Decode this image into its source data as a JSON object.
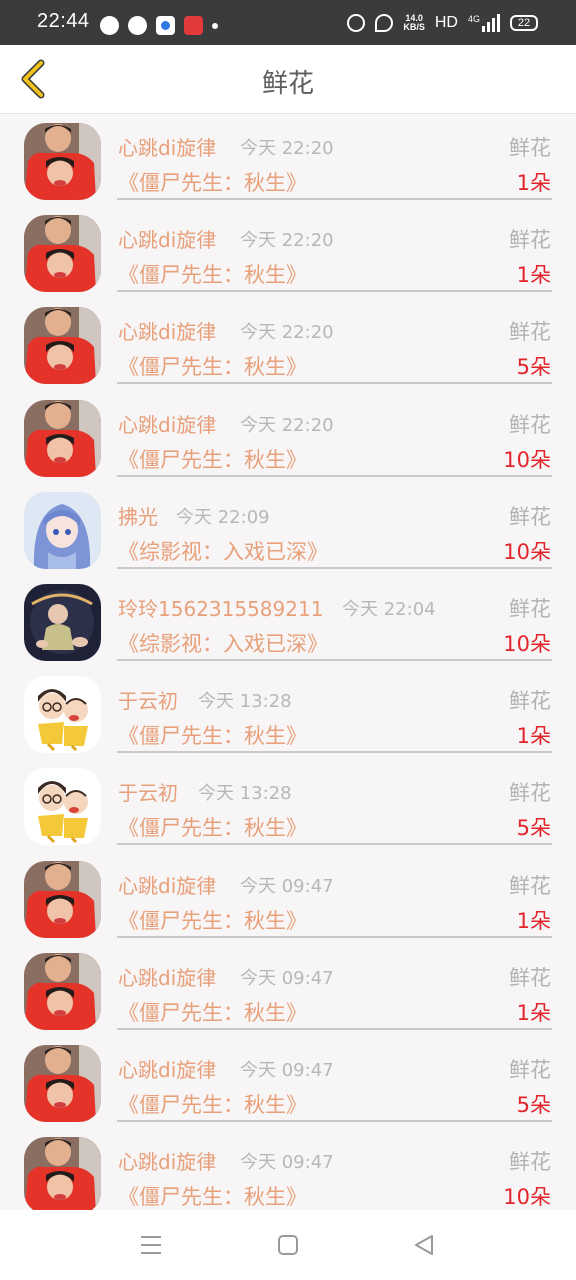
{
  "status_bar": {
    "time": "22:44",
    "net_speed": "14.0",
    "net_unit": "KB/S",
    "hd": "HD",
    "network": "4G",
    "battery": "22"
  },
  "header": {
    "title": "鲜花",
    "back_icon": "chevron-left-icon"
  },
  "records": [
    {
      "name": "心跳di旋律",
      "time": "今天 22:20",
      "tag": "鲜花",
      "book": "《僵尸先生：秋生》",
      "count": "1朵",
      "avatar": "photo-boy-girl"
    },
    {
      "name": "心跳di旋律",
      "time": "今天 22:20",
      "tag": "鲜花",
      "book": "《僵尸先生：秋生》",
      "count": "1朵",
      "avatar": "photo-boy-girl"
    },
    {
      "name": "心跳di旋律",
      "time": "今天 22:20",
      "tag": "鲜花",
      "book": "《僵尸先生：秋生》",
      "count": "5朵",
      "avatar": "photo-boy-girl"
    },
    {
      "name": "心跳di旋律",
      "time": "今天 22:20",
      "tag": "鲜花",
      "book": "《僵尸先生：秋生》",
      "count": "10朵",
      "avatar": "photo-boy-girl"
    },
    {
      "name": "拂光",
      "time": "今天 22:09",
      "tag": "鲜花",
      "book": "《综影视：入戏已深》",
      "count": "10朵",
      "avatar": "anime-girl"
    },
    {
      "name": "玲玲1562315589211",
      "time": "今天 22:04",
      "tag": "鲜花",
      "book": "《综影视：入戏已深》",
      "count": "10朵",
      "avatar": "baby-photo"
    },
    {
      "name": "于云初",
      "time": "今天 13:28",
      "tag": "鲜花",
      "book": "《僵尸先生：秋生》",
      "count": "1朵",
      "avatar": "cartoon-couple"
    },
    {
      "name": "于云初",
      "time": "今天 13:28",
      "tag": "鲜花",
      "book": "《僵尸先生：秋生》",
      "count": "5朵",
      "avatar": "cartoon-couple"
    },
    {
      "name": "心跳di旋律",
      "time": "今天 09:47",
      "tag": "鲜花",
      "book": "《僵尸先生：秋生》",
      "count": "1朵",
      "avatar": "photo-boy-girl"
    },
    {
      "name": "心跳di旋律",
      "time": "今天 09:47",
      "tag": "鲜花",
      "book": "《僵尸先生：秋生》",
      "count": "1朵",
      "avatar": "photo-boy-girl"
    },
    {
      "name": "心跳di旋律",
      "time": "今天 09:47",
      "tag": "鲜花",
      "book": "《僵尸先生：秋生》",
      "count": "5朵",
      "avatar": "photo-boy-girl"
    },
    {
      "name": "心跳di旋律",
      "time": "今天 09:47",
      "tag": "鲜花",
      "book": "《僵尸先生：秋生》",
      "count": "10朵",
      "avatar": "photo-boy-girl"
    }
  ],
  "nav": {
    "menu_icon": "menu-icon",
    "home_icon": "home-square-icon",
    "back_icon": "back-triangle-icon"
  },
  "colors": {
    "accent_name": "#e8a07a",
    "count_red": "#e3242b",
    "back_yellow": "#f1c21b"
  }
}
